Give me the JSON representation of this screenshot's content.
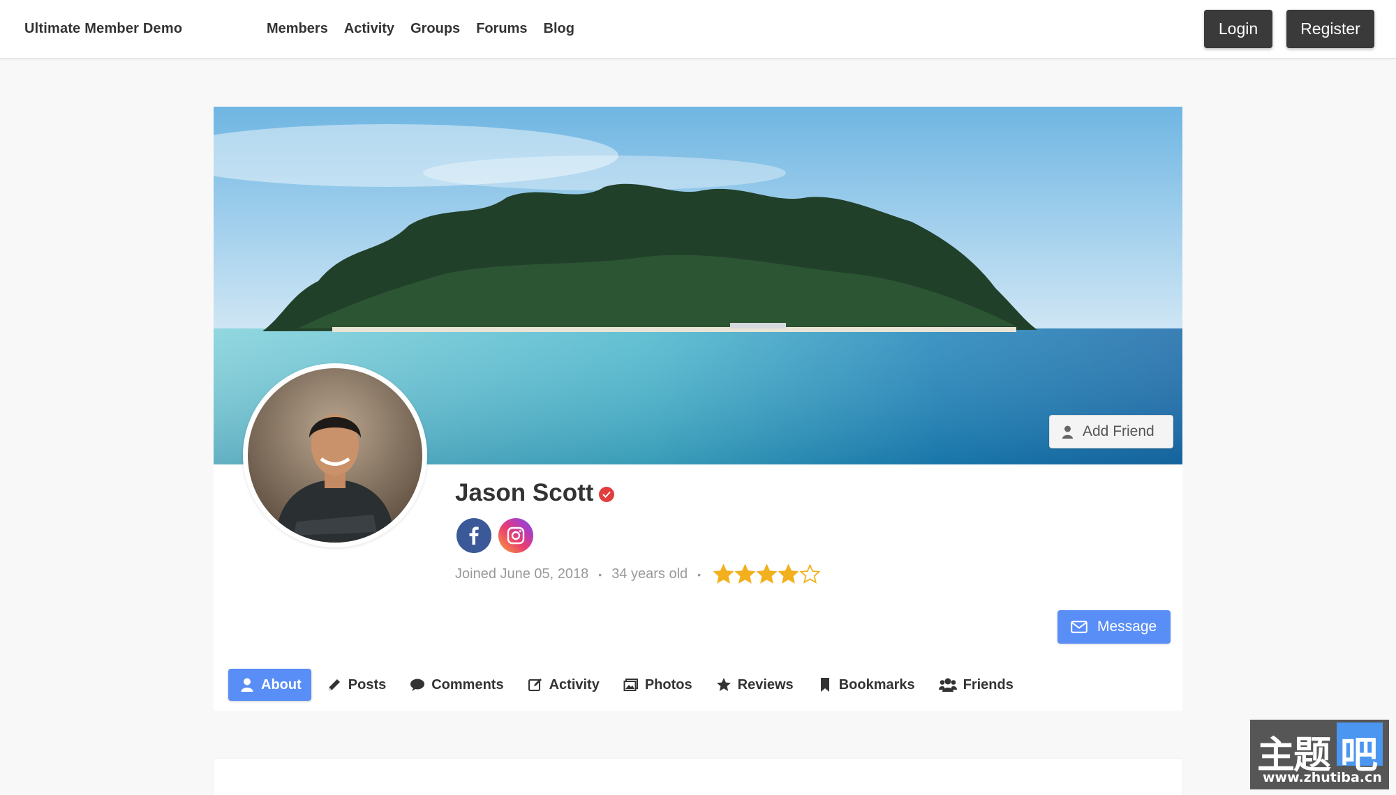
{
  "header": {
    "site_title": "Ultimate Member Demo",
    "nav": [
      "Members",
      "Activity",
      "Groups",
      "Forums",
      "Blog"
    ],
    "login_label": "Login",
    "register_label": "Register"
  },
  "profile": {
    "name": "Jason Scott",
    "verified": true,
    "joined": "Joined June 05, 2018",
    "age": "34 years old",
    "rating": 4,
    "rating_max": 5,
    "social_icons": [
      "facebook-icon",
      "instagram-icon"
    ],
    "add_friend_label": "Add Friend",
    "message_label": "Message"
  },
  "tabs": [
    {
      "label": "About",
      "icon": "user-icon",
      "active": true
    },
    {
      "label": "Posts",
      "icon": "pencil-icon",
      "active": false
    },
    {
      "label": "Comments",
      "icon": "comment-icon",
      "active": false
    },
    {
      "label": "Activity",
      "icon": "edit-icon",
      "active": false
    },
    {
      "label": "Photos",
      "icon": "photos-icon",
      "active": false
    },
    {
      "label": "Reviews",
      "icon": "star-icon",
      "active": false
    },
    {
      "label": "Bookmarks",
      "icon": "bookmark-icon",
      "active": false
    },
    {
      "label": "Friends",
      "icon": "users-icon",
      "active": false
    }
  ],
  "watermark": {
    "main": "主题",
    "box": "吧",
    "url": "www.zhutiba.cn"
  },
  "colors": {
    "accent": "#5a8ef7",
    "dark_button": "#3a3a3a",
    "star": "#f2b01e",
    "verified": "#e23d3d"
  }
}
